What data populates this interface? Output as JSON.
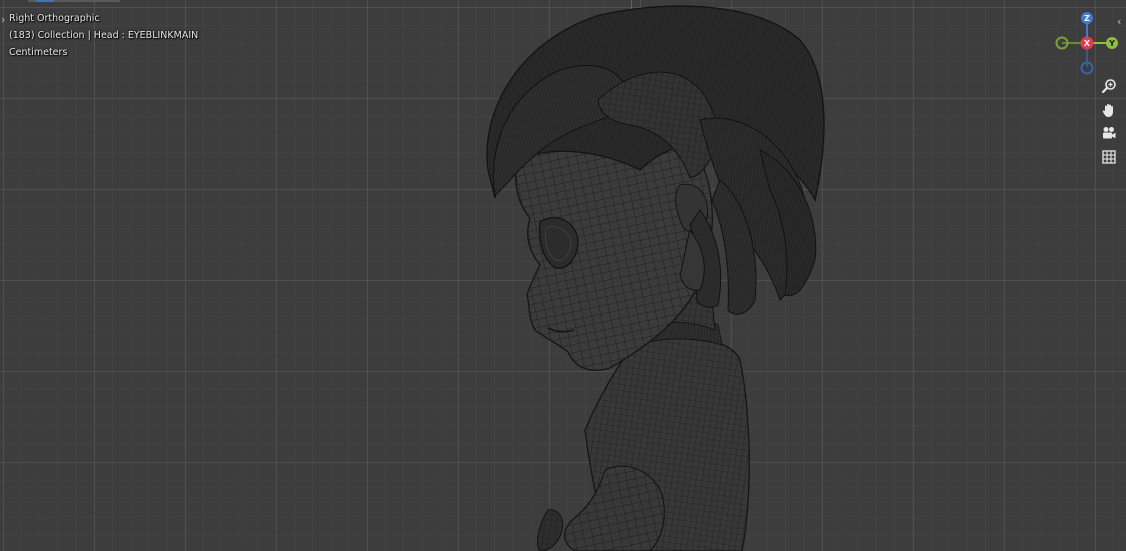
{
  "viewport": {
    "view_name": "Right Orthographic",
    "collection_info": "(183) Collection | Head : EYEBLINKMAIN",
    "units": "Centimeters"
  },
  "gizmo": {
    "z_label": "Z",
    "x_label": "X",
    "y_label": "Y",
    "colors": {
      "x": "#e2394c",
      "y": "#8bc13b",
      "z": "#3f7ad6",
      "neg_y": "#76a336",
      "neg_z": "#3464ad"
    }
  },
  "nav_tools": [
    {
      "name": "zoom",
      "icon": "zoom-icon"
    },
    {
      "name": "pan",
      "icon": "hand-icon"
    },
    {
      "name": "camera",
      "icon": "camera-icon"
    },
    {
      "name": "grid",
      "icon": "grid-icon"
    }
  ],
  "colors": {
    "background": "#3d3d3d",
    "grid_major": "#5a5a5a",
    "z_axis_line": "#3f6fb4",
    "wire": "#151515",
    "hair_fill": "#2b2b2b"
  }
}
